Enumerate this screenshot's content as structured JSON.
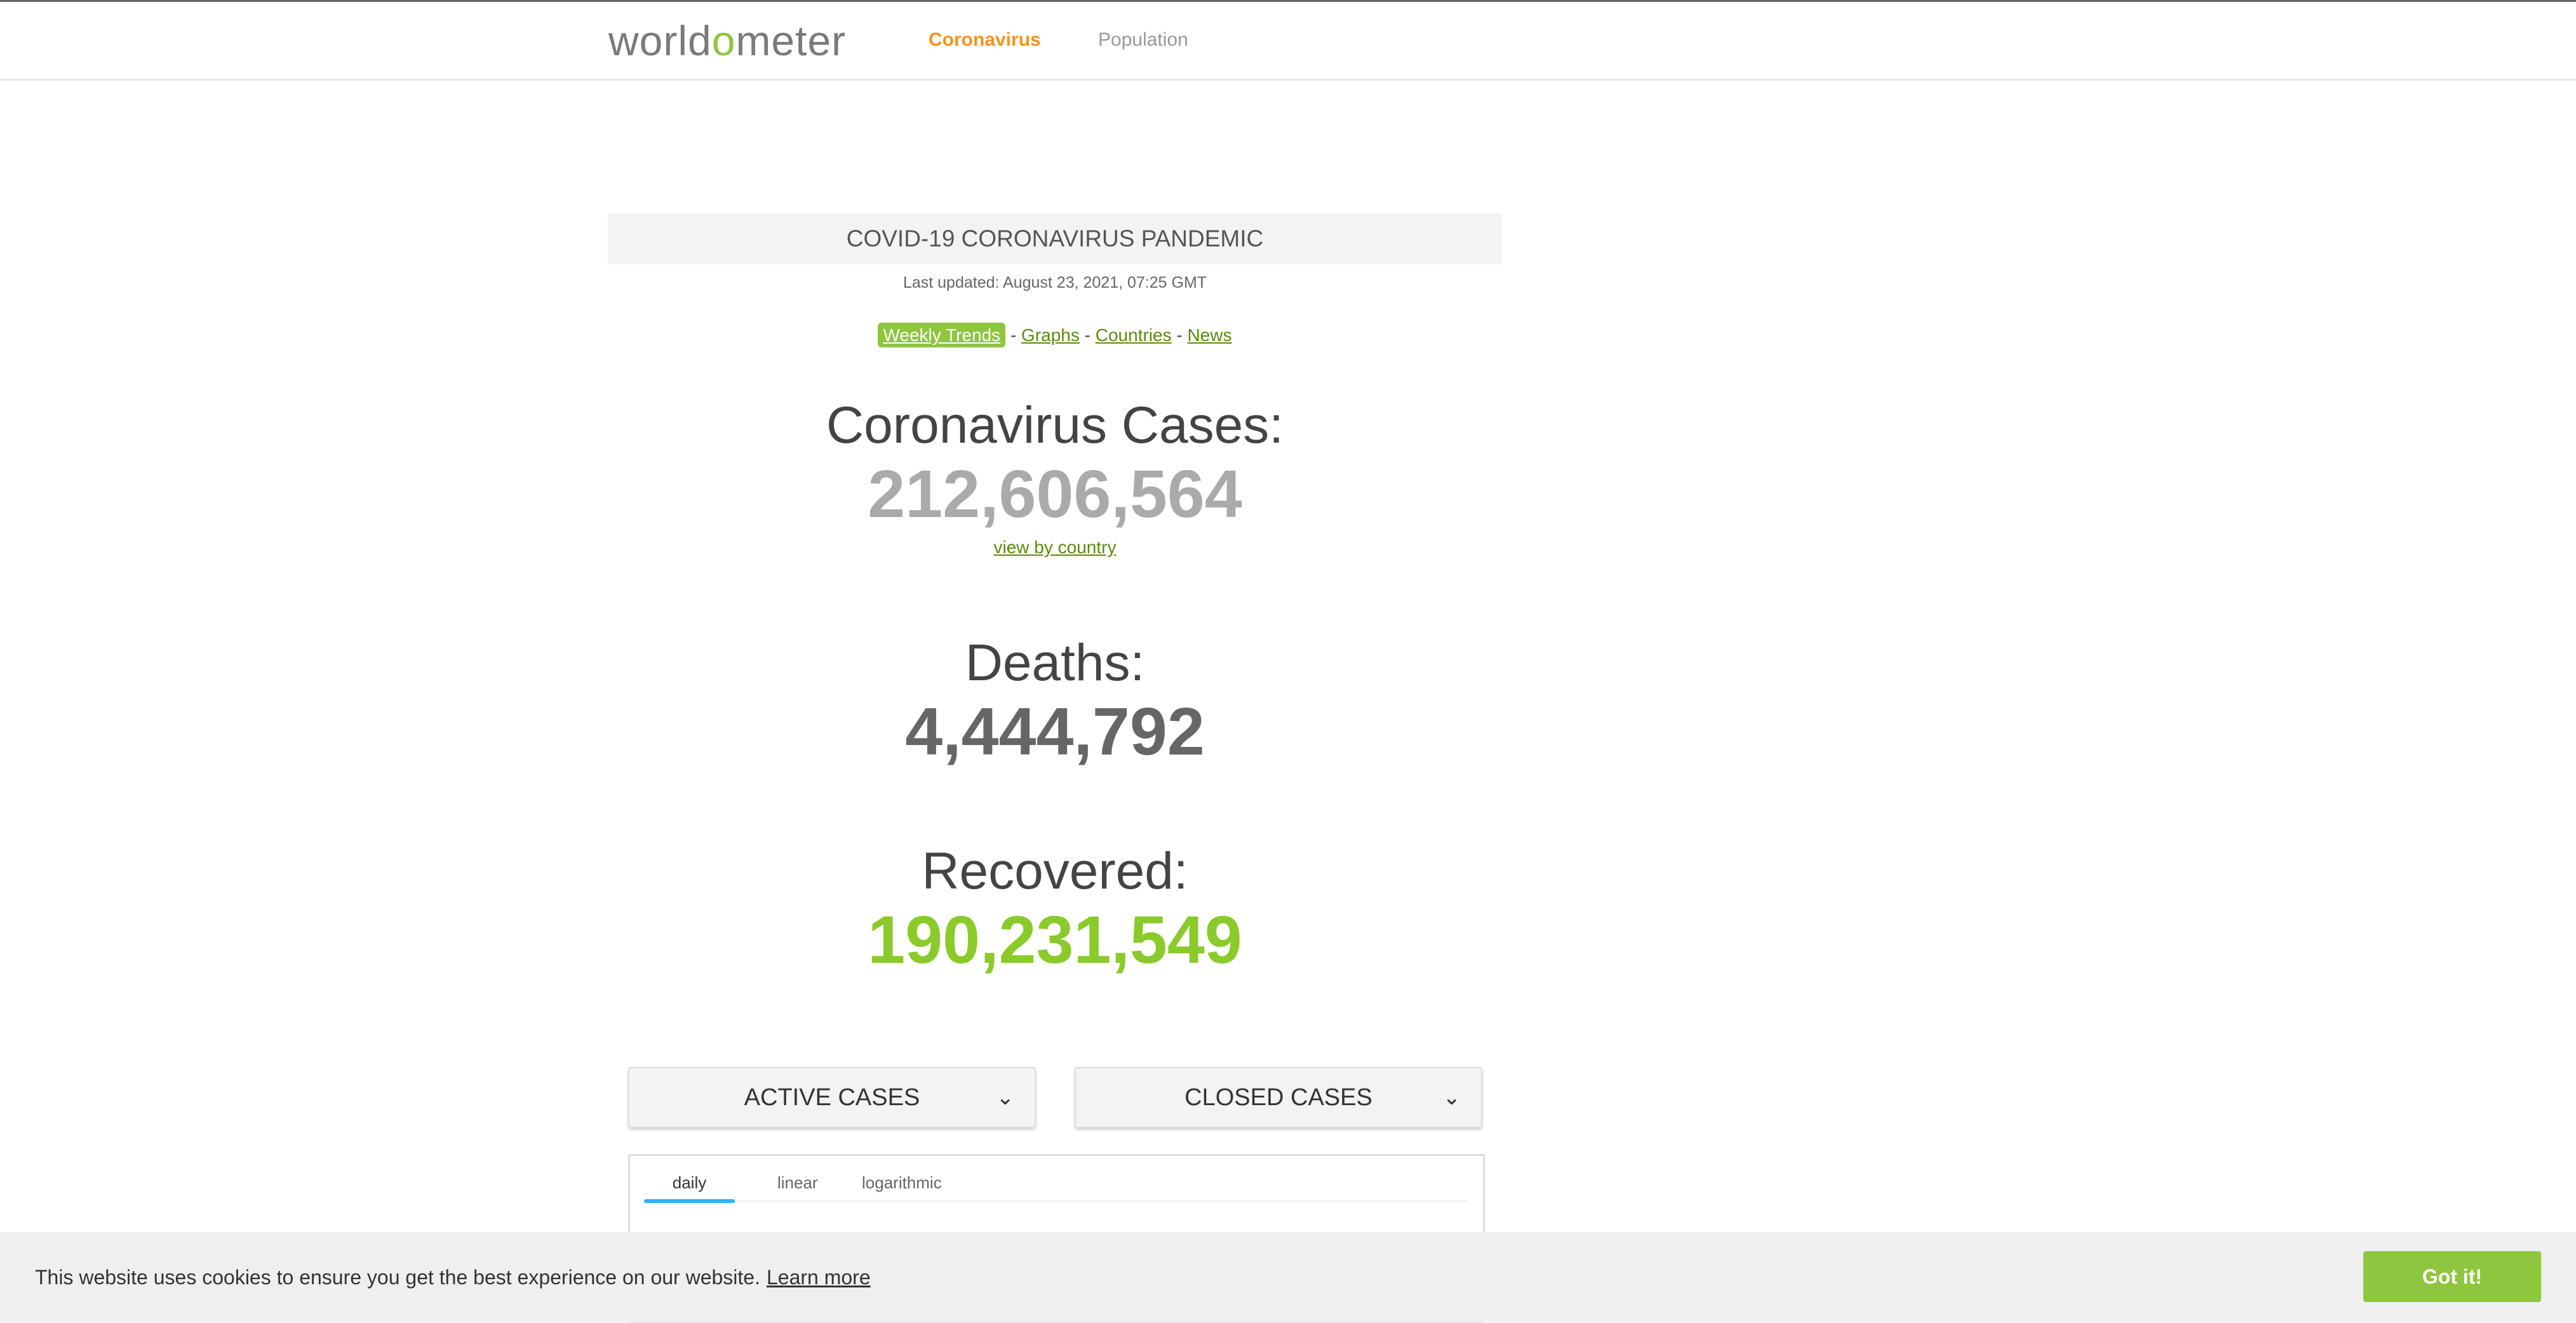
{
  "nav": {
    "logo_pre": "world",
    "logo_o": "o",
    "logo_post": "meter",
    "links": [
      "Coronavirus",
      "Population"
    ]
  },
  "page": {
    "title": "COVID-19 CORONAVIRUS PANDEMIC",
    "last_updated": "Last updated: August 23, 2021, 07:25 GMT",
    "quick_links": [
      "Weekly Trends",
      "Graphs",
      "Countries",
      "News"
    ],
    "separator": "-"
  },
  "stats": {
    "cases_label": "Coronavirus Cases:",
    "cases_value": "212,606,564",
    "view_by_country": "view by country",
    "deaths_label": "Deaths:",
    "deaths_value": "4,444,792",
    "recovered_label": "Recovered:",
    "recovered_value": "190,231,549"
  },
  "panels": {
    "active": "ACTIVE CASES",
    "closed": "CLOSED CASES"
  },
  "chart_tabs": [
    "daily",
    "linear",
    "logarithmic"
  ],
  "cookie": {
    "message": "This website uses cookies to ensure you get the best experience on our website.",
    "learn_more": "Learn more",
    "accept": "Got it!"
  },
  "colors": {
    "brand_green": "#8ec63f",
    "nav_orange": "#f6921e",
    "tab_indicator": "#29b6f6"
  }
}
